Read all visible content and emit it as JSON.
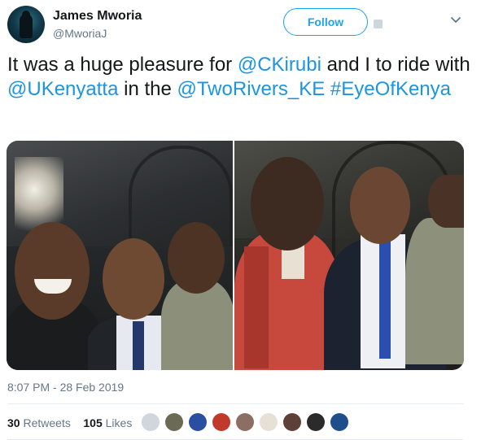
{
  "author": {
    "display_name": "James Mworia",
    "handle": "@MworiaJ"
  },
  "follow_button": {
    "label": "Follow"
  },
  "tweet": {
    "text_segments": [
      {
        "text": "It was a huge pleasure for ",
        "link": false
      },
      {
        "text": "@CKirubi",
        "link": true
      },
      {
        "text": " and I to ride with ",
        "link": false
      },
      {
        "text": "@UKenyatta",
        "link": true
      },
      {
        "text": " in the ",
        "link": false
      },
      {
        "text": "@TwoRivers_KE",
        "link": true
      },
      {
        "text": " ",
        "link": false
      },
      {
        "text": "#EyeOfKenya",
        "link": true
      }
    ]
  },
  "timestamp": "8:07 PM - 28 Feb 2019",
  "stats": {
    "retweets_count": "30",
    "retweets_label": "Retweets",
    "likes_count": "105",
    "likes_label": "Likes"
  },
  "colors": {
    "link": "#1b95e0",
    "muted": "#657786",
    "follow_border": "#1da1f2",
    "text": "#14171a"
  },
  "icons": [
    "chevron-down-icon",
    "verified-badge-icon"
  ],
  "liker_avatar_colors": [
    "#cfd6dc",
    "#6b6a55",
    "#2a4ea0",
    "#c0392b",
    "#8d6e63",
    "#e7e0d7",
    "#5d4037",
    "#2b2b2b",
    "#1f4e8c"
  ]
}
